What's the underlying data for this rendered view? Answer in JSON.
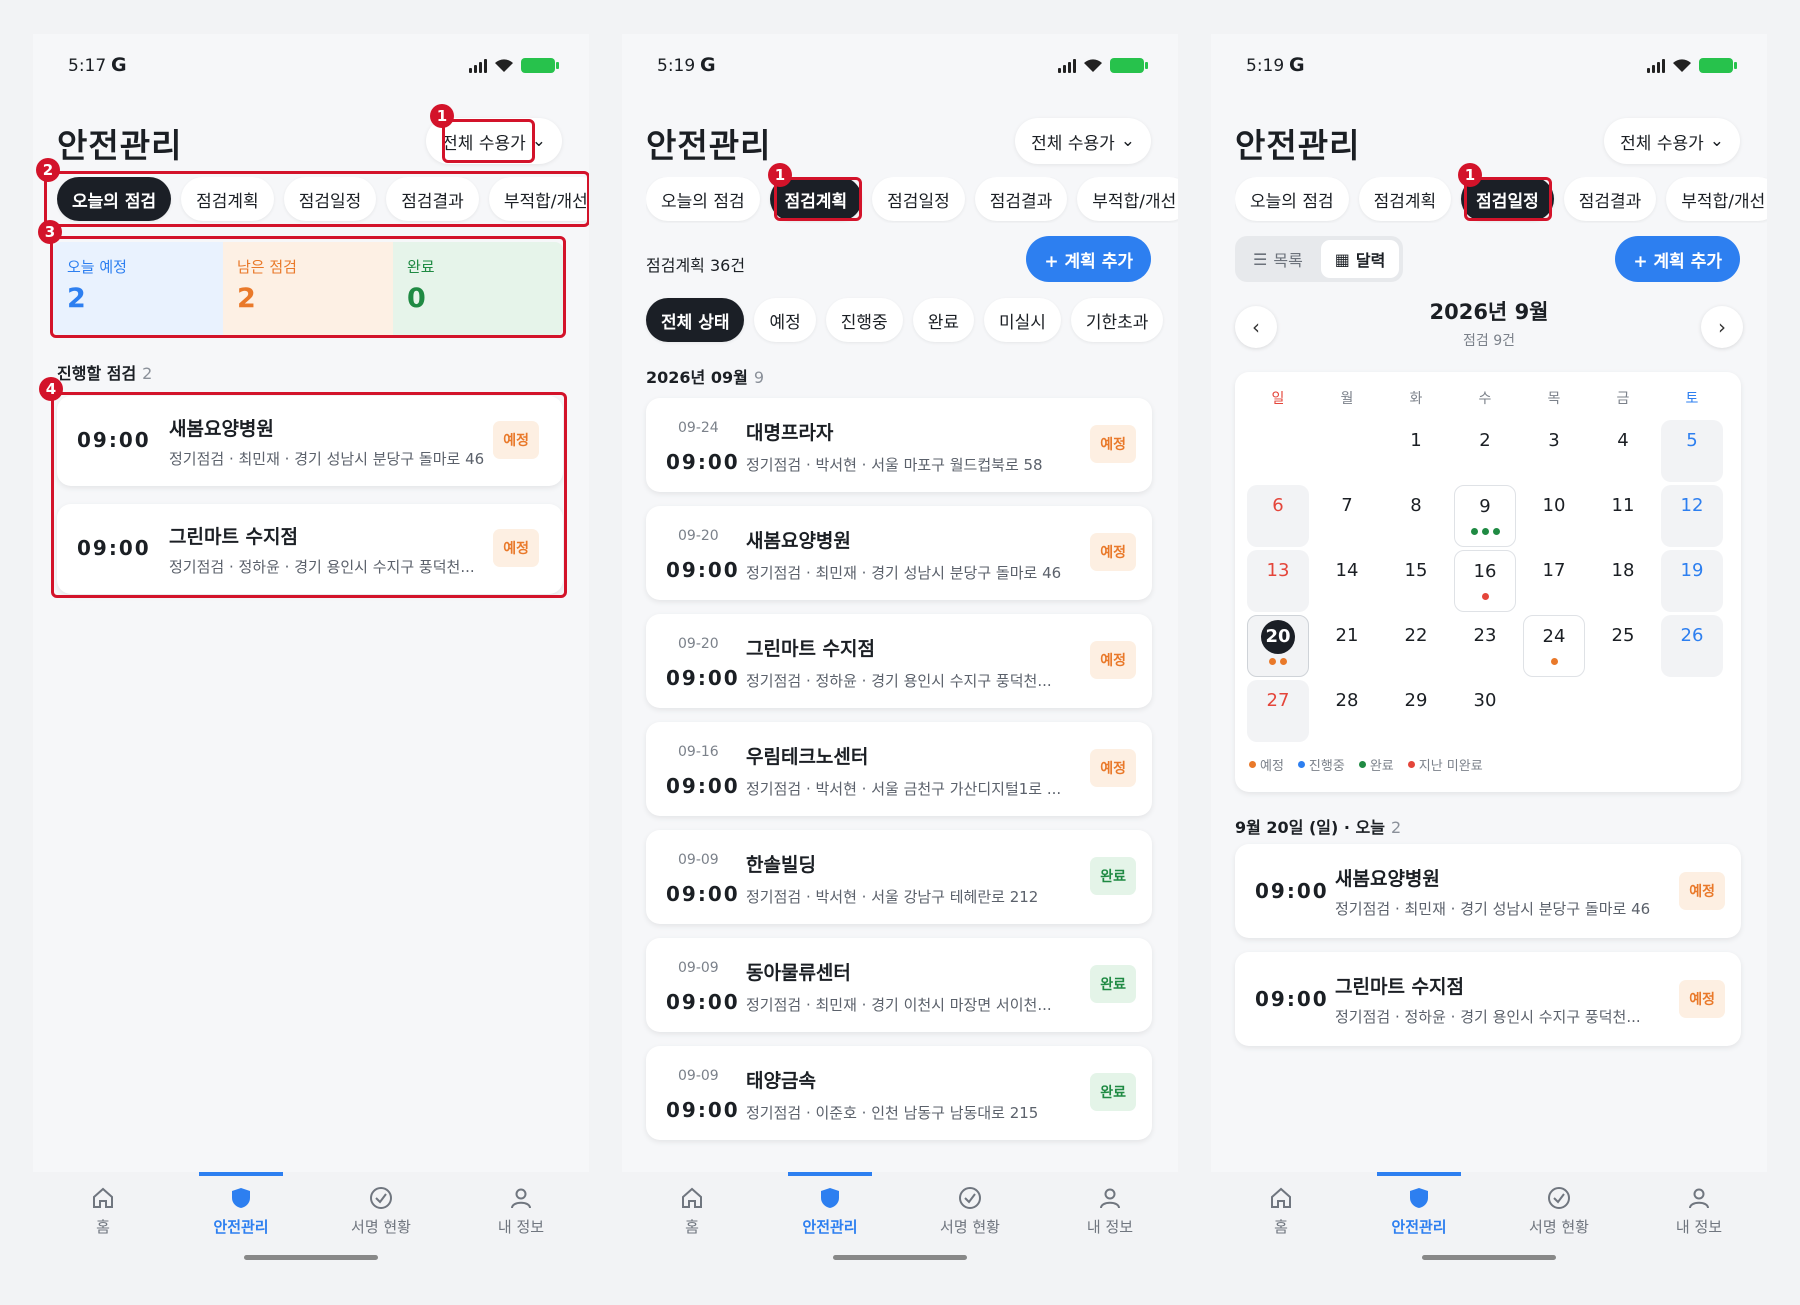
{
  "colors": {
    "accent": "#2d7ff0",
    "plan": "#e9792a",
    "done": "#1f8a43",
    "overdue": "#e4453a",
    "annotation": "#d3132a"
  },
  "screens": [
    {
      "status": {
        "time": "5:17",
        "carrier_icon": "G"
      },
      "title": "안전관리",
      "filter": "전체 수용가",
      "tabs": [
        "오늘의 점검",
        "점검계획",
        "점검일정",
        "점검결과",
        "부적합/개선"
      ],
      "stats": [
        {
          "label": "오늘 예정",
          "value": "2"
        },
        {
          "label": "남은 점검",
          "value": "2"
        },
        {
          "label": "완료",
          "value": "0"
        }
      ],
      "section": {
        "label": "진행할 점검",
        "count": "2"
      },
      "cards": [
        {
          "time": "09:00",
          "name": "새봄요양병원",
          "meta": "정기점검 · 최민재 · 경기 성남시 분당구 돌마로 46",
          "status": "예정"
        },
        {
          "time": "09:00",
          "name": "그린마트 수지점",
          "meta": "정기점검 · 정하윤 · 경기 용인시 수지구 풍덕천...",
          "status": "예정"
        }
      ],
      "annotations": [
        "1",
        "2",
        "3",
        "4"
      ]
    },
    {
      "status": {
        "time": "5:19",
        "carrier_icon": "G"
      },
      "title": "안전관리",
      "filter": "전체 수용가",
      "tabs": [
        "오늘의 점검",
        "점검계획",
        "점검일정",
        "점검결과",
        "부적합/개선"
      ],
      "count_label": "점검계획 36건",
      "add_button": "+ 계획 추가",
      "status_filters": [
        "전체 상태",
        "예정",
        "진행중",
        "완료",
        "미실시",
        "기한초과"
      ],
      "month": {
        "label": "2026년 09월",
        "count": "9"
      },
      "items": [
        {
          "date": "09-24",
          "time": "09:00",
          "name": "대명프라자",
          "meta": "정기점검 · 박서현 · 서울 마포구 월드컵북로 58",
          "status": "예정",
          "kind": "plan"
        },
        {
          "date": "09-20",
          "time": "09:00",
          "name": "새봄요양병원",
          "meta": "정기점검 · 최민재 · 경기 성남시 분당구 돌마로 46",
          "status": "예정",
          "kind": "plan"
        },
        {
          "date": "09-20",
          "time": "09:00",
          "name": "그린마트 수지점",
          "meta": "정기점검 · 정하윤 · 경기 용인시 수지구 풍덕천...",
          "status": "예정",
          "kind": "plan"
        },
        {
          "date": "09-16",
          "time": "09:00",
          "name": "우림테크노센터",
          "meta": "정기점검 · 박서현 · 서울 금천구 가산디지털1로 ...",
          "status": "예정",
          "kind": "plan"
        },
        {
          "date": "09-09",
          "time": "09:00",
          "name": "한솔빌딩",
          "meta": "정기점검 · 박서현 · 서울 강남구 테헤란로 212",
          "status": "완료",
          "kind": "done"
        },
        {
          "date": "09-09",
          "time": "09:00",
          "name": "동아물류센터",
          "meta": "정기점검 · 최민재 · 경기 이천시 마장면 서이천...",
          "status": "완료",
          "kind": "done"
        },
        {
          "date": "09-09",
          "time": "09:00",
          "name": "태양금속",
          "meta": "정기점검 · 이준호 · 인천 남동구 남동대로 215",
          "status": "완료",
          "kind": "done"
        }
      ],
      "annotations": [
        "1"
      ]
    },
    {
      "status": {
        "time": "5:19",
        "carrier_icon": "G"
      },
      "title": "안전관리",
      "filter": "전체 수용가",
      "tabs": [
        "오늘의 점검",
        "점검계획",
        "점검일정",
        "점검결과",
        "부적합/개선"
      ],
      "view_toggle": {
        "list": "목록",
        "calendar": "달력"
      },
      "add_button": "+ 계획 추가",
      "calendar": {
        "title": "2026년 9월",
        "subtitle": "점검 9건",
        "weekdays": [
          "일",
          "월",
          "화",
          "수",
          "목",
          "금",
          "토"
        ],
        "today": "20",
        "legend": [
          "예정",
          "진행중",
          "완료",
          "지난 미완료"
        ]
      },
      "today_section": {
        "label": "9월 20일 (일) · 오늘",
        "count": "2"
      },
      "cards": [
        {
          "time": "09:00",
          "name": "새봄요양병원",
          "meta": "정기점검 · 최민재 · 경기 성남시 분당구 돌마로 46",
          "status": "예정"
        },
        {
          "time": "09:00",
          "name": "그린마트 수지점",
          "meta": "정기점검 · 정하윤 · 경기 용인시 수지구 풍덕천...",
          "status": "예정"
        }
      ],
      "annotations": [
        "1"
      ]
    }
  ],
  "nav": [
    "홈",
    "안전관리",
    "서명 현황",
    "내 정보"
  ]
}
